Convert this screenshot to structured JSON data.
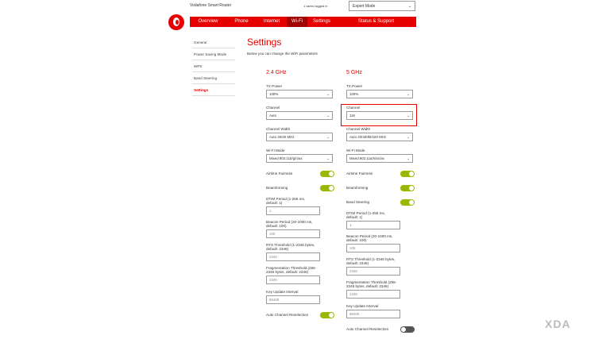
{
  "header": {
    "brand": "Vodafone Smart Router",
    "users_logged_in": "1 users logged in",
    "mode_select": "Expert Mode"
  },
  "nav": {
    "items": [
      {
        "label": "Overview"
      },
      {
        "label": "Phone"
      },
      {
        "label": "Internet"
      },
      {
        "label": "Wi-Fi"
      },
      {
        "label": "Settings"
      },
      {
        "label": "Status & Support"
      }
    ]
  },
  "sidebar": {
    "items": [
      {
        "label": "General"
      },
      {
        "label": "Power Saving Mode"
      },
      {
        "label": "WPS"
      },
      {
        "label": "Band Steering"
      },
      {
        "label": "Settings"
      }
    ]
  },
  "page": {
    "title": "Settings",
    "subtitle": "Below you can change the WiFi parameters"
  },
  "band24": {
    "heading": "2.4 GHz",
    "tx_power_label": "TX Power",
    "tx_power_value": "100%",
    "channel_label": "Channel",
    "channel_value": "Auto",
    "width_label": "Channel Width",
    "width_value": "Auto 20/40 MHz",
    "mode_label": "Wi-Fi Mode",
    "mode_value": "Mixed 802.11b/g/n/ax",
    "airtime_label": "Airtime Fairness",
    "beamforming_label": "Beamforming",
    "dtim_label": "DTIM Period (1-255 ms, default: 1)",
    "dtim_value": "1",
    "beacon_label": "Beacon Period (20-1000 ms, default: 100)",
    "beacon_value": "100",
    "rts_label": "RTS Threshold (1-2346 bytes, default: 2346)",
    "rts_value": "2346",
    "frag_label": "Fragmentation Threshold (256-2346 bytes, default: 2346)",
    "frag_value": "2346",
    "key_label": "Key Update Interval",
    "key_value": "86400",
    "acr_label": "Auto Channel Reselection"
  },
  "band5": {
    "heading": "5 GHz",
    "tx_power_label": "TX Power",
    "tx_power_value": "100%",
    "channel_label": "Channel",
    "channel_value": "116",
    "width_label": "Channel Width",
    "width_value": "Auto 20/40/80/160 MHz",
    "mode_label": "Wi-Fi Mode",
    "mode_value": "Mixed 802.11a/n/ac/ax",
    "airtime_label": "Airtime Fairness",
    "beamforming_label": "Beamforming",
    "band_steering_label": "Band Steering",
    "dtim_label": "DTIM Period (1-255 ms, default: 1)",
    "dtim_value": "1",
    "beacon_label": "Beacon Period (20-1000 ms, default: 100)",
    "beacon_value": "100",
    "rts_label": "RTS Threshold (1-2346 bytes, default: 2346)",
    "rts_value": "2346",
    "frag_label": "Fragmentation Threshold (256-2346 bytes, default: 2346)",
    "frag_value": "2346",
    "key_label": "Key Update Interval",
    "key_value": "86400",
    "acr_label": "Auto Channel Reselection"
  },
  "watermark": "XDA",
  "colors": {
    "brand_red": "#e60000",
    "toggle_on": "#9ab800"
  }
}
